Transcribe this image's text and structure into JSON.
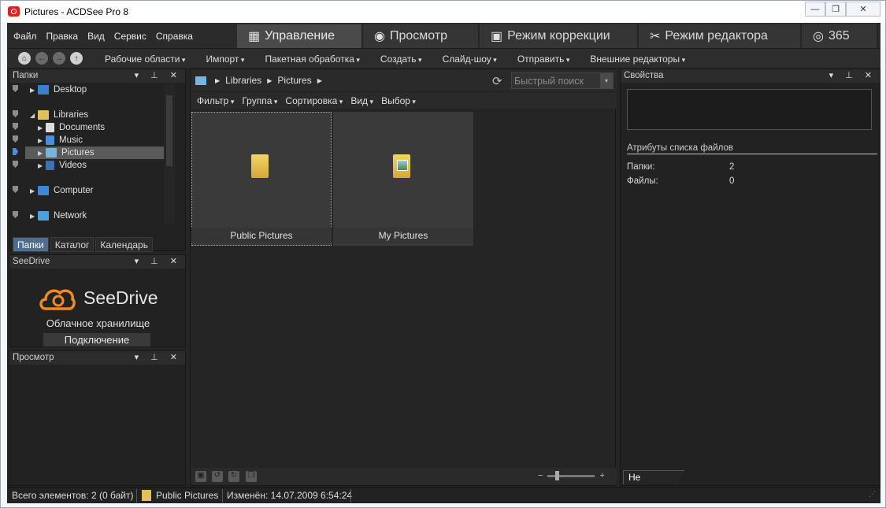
{
  "window": {
    "title": "Pictures - ACDSee Pro 8",
    "controls": [
      "—",
      "❐",
      "✕"
    ]
  },
  "menu": [
    "Файл",
    "Правка",
    "Вид",
    "Сервис",
    "Справка"
  ],
  "mode_tabs": [
    {
      "label": "Управление",
      "icon": "grid-icon"
    },
    {
      "label": "Просмотр",
      "icon": "eye-icon"
    },
    {
      "label": "Режим коррекции",
      "icon": "image-icon"
    },
    {
      "label": "Режим редактора",
      "icon": "tools-icon"
    },
    {
      "label": "365",
      "icon": "badge-365-icon"
    }
  ],
  "toolbar": [
    "Рабочие области",
    "Импорт",
    "Пакетная обработка",
    "Создать",
    "Слайд-шоу",
    "Отправить",
    "Внешние редакторы"
  ],
  "folders_panel": {
    "title": "Папки",
    "tree": [
      {
        "label": "Desktop"
      },
      {
        "label": "Libraries"
      },
      {
        "label": "Documents"
      },
      {
        "label": "Music"
      },
      {
        "label": "Pictures"
      },
      {
        "label": "Videos"
      },
      {
        "label": "Computer"
      },
      {
        "label": "Network"
      }
    ],
    "tabs": [
      "Папки",
      "Каталог",
      "Календарь"
    ]
  },
  "seedrive_panel": {
    "title": "SeeDrive",
    "brand": "SeeDrive",
    "subtitle": "Облачное хранилище",
    "connect": "Подключение"
  },
  "preview_panel": {
    "title": "Просмотр"
  },
  "path": {
    "crumbs": [
      "Libraries",
      "Pictures"
    ],
    "search_placeholder": "Быстрый поиск"
  },
  "filterbar": [
    "Фильтр",
    "Группа",
    "Сортировка",
    "Вид",
    "Выбор"
  ],
  "items": [
    {
      "label": "Public Pictures"
    },
    {
      "label": "My Pictures"
    }
  ],
  "properties": {
    "title": "Свойства",
    "attr_header": "Атрибуты списка файлов",
    "rows": [
      {
        "label": "Папки:",
        "value": "2"
      },
      {
        "label": "Файлы:",
        "value": "0"
      }
    ],
    "tab": "Не выбрано"
  },
  "status": {
    "total": "Всего элементов: 2  (0 байт)",
    "current": "Public Pictures",
    "modified": "Изменён: 14.07.2009 6:54:24"
  }
}
